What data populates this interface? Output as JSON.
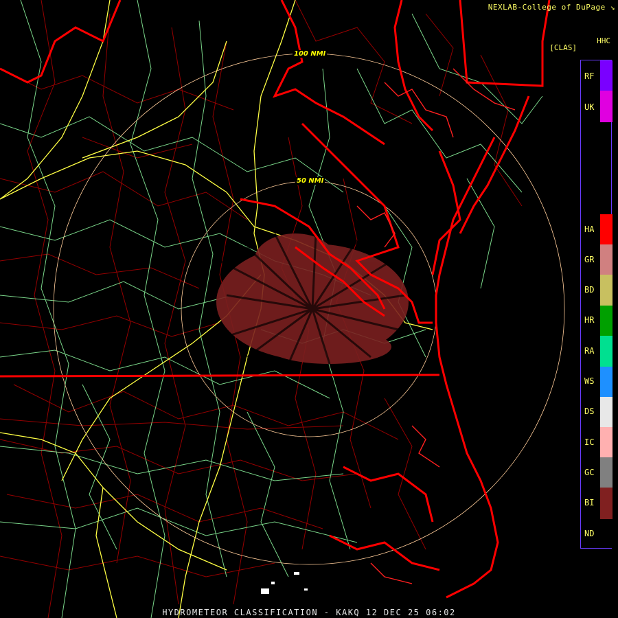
{
  "header": {
    "credit": "NEXLAB-College of DuPage",
    "credit_icon": "arrow-out-icon",
    "product_code": "HHC",
    "product_tag": "[CLAS]"
  },
  "range_rings": {
    "inner": "50 NMI",
    "outer": "100 NMI"
  },
  "legend": {
    "items": [
      {
        "code": "RF",
        "color": "#7a00ff"
      },
      {
        "code": "UK",
        "color": "#e000e0"
      },
      {
        "code": "HA",
        "color": "#ff0000"
      },
      {
        "code": "GR",
        "color": "#d08080"
      },
      {
        "code": "BD",
        "color": "#c8c060"
      },
      {
        "code": "HR",
        "color": "#00a000"
      },
      {
        "code": "RA",
        "color": "#00e090"
      },
      {
        "code": "WS",
        "color": "#1e90ff"
      },
      {
        "code": "DS",
        "color": "#e8e8e8"
      },
      {
        "code": "IC",
        "color": "#ffb0b0"
      },
      {
        "code": "GC",
        "color": "#808080"
      },
      {
        "code": "BI",
        "color": "#802020"
      },
      {
        "code": "ND",
        "color": "#000000"
      }
    ]
  },
  "colors": {
    "state_lines": "#ff0000",
    "county_lines": "#c00000",
    "highways": "#ffff44",
    "roads": "#88ee99",
    "range_rings": "#ffcc99",
    "echo": "#7a2020"
  },
  "footer": {
    "title": "HYDROMETEOR CLASSIFICATION - KAKQ 12 DEC 25 06:02"
  }
}
